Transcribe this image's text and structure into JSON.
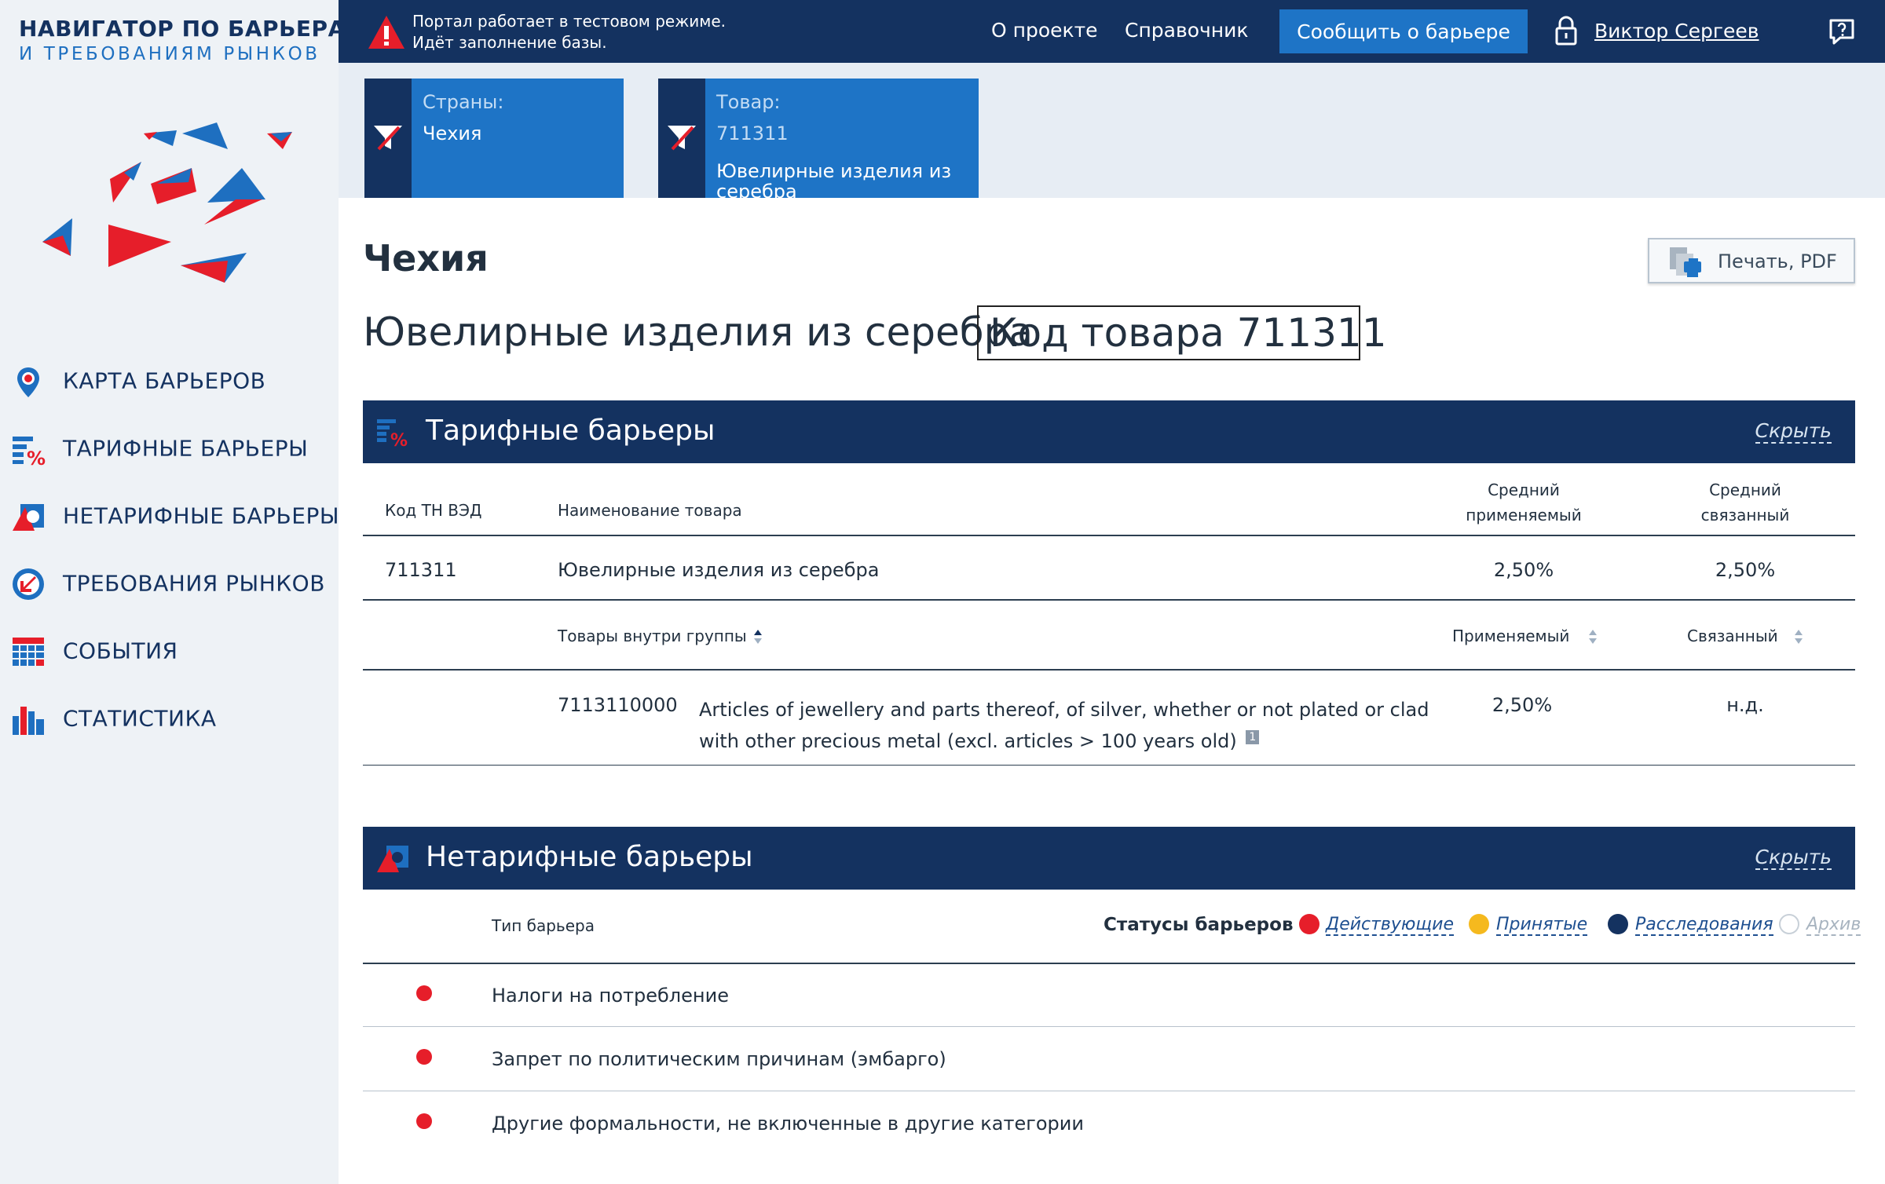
{
  "brand": {
    "line1": "НАВИГАТОР ПО БАРЬЕРАМ",
    "line2": "И ТРЕБОВАНИЯМ РЫНКОВ"
  },
  "nav": {
    "items": [
      {
        "label": "КАРТА БАРЬЕРОВ",
        "icon": "map-pin-icon"
      },
      {
        "label": "ТАРИФНЫЕ БАРЬЕРЫ",
        "icon": "tariff-percent-icon"
      },
      {
        "label": "НЕТАРИФНЫЕ БАРЬЕРЫ",
        "icon": "nontariff-shape-icon"
      },
      {
        "label": "ТРЕБОВАНИЯ РЫНКОВ",
        "icon": "requirements-arrow-icon"
      },
      {
        "label": "СОБЫТИЯ",
        "icon": "calendar-grid-icon"
      },
      {
        "label": "СТАТИСТИКА",
        "icon": "bar-chart-icon"
      }
    ]
  },
  "header": {
    "notice_line1": "Портал работает в тестовом режиме.",
    "notice_line2": "Идёт заполнение базы.",
    "about": "О проекте",
    "reference": "Справочник",
    "report_button": "Сообщить о барьере",
    "user_name": "Виктор Сергеев"
  },
  "filters": {
    "countries_label": "Страны:",
    "countries_value": "Чехия",
    "product_label": "Товар:",
    "product_code": "711311",
    "product_line1": "Ювелирные изделия из",
    "product_line2": "серебра"
  },
  "page": {
    "country": "Чехия",
    "product_name": "Ювелирные изделия из серебра",
    "code_label": "Код товара 711311",
    "print_button": "Печать, PDF"
  },
  "tariff": {
    "title": "Тарифные барьеры",
    "hide": "Скрыть",
    "col_code": "Код ТН ВЭД",
    "col_name": "Наименование товара",
    "col_avg_applied_1": "Средний",
    "col_avg_applied_2": "применяемый",
    "col_avg_bound_1": "Средний",
    "col_avg_bound_2": "связанный",
    "row_code": "711311",
    "row_name": "Ювелирные изделия из серебра",
    "row_applied": "2,50%",
    "row_bound": "2,50%",
    "sub_goods": "Товары внутри группы",
    "sub_applied": "Применяемый",
    "sub_bound": "Связанный",
    "item_code": "7113110000",
    "item_desc_1": "Articles of jewellery and parts thereof, of silver, whether or not plated or clad",
    "item_desc_2": "with other precious metal (excl. articles > 100 years old)",
    "item_footnote": "1",
    "item_applied": "2,50%",
    "item_bound": "н.д."
  },
  "nontariff": {
    "title": "Нетарифные барьеры",
    "hide": "Скрыть",
    "col_type": "Тип барьера",
    "statuses_label": "Статусы барьеров",
    "status_active": "Действующие",
    "status_adopted": "Принятые",
    "status_investigation": "Расследования",
    "status_archive": "Архив",
    "colors": {
      "active": "#e61e2a",
      "adopted": "#f5b91e",
      "investigation": "#143260",
      "archive": "#ffffff"
    },
    "rows": [
      {
        "label": "Налоги на потребление",
        "status": "active"
      },
      {
        "label": "Запрет по политическим причинам (эмбарго)",
        "status": "active"
      },
      {
        "label": "Другие формальности, не включенные в другие категории",
        "status": "active"
      }
    ]
  }
}
